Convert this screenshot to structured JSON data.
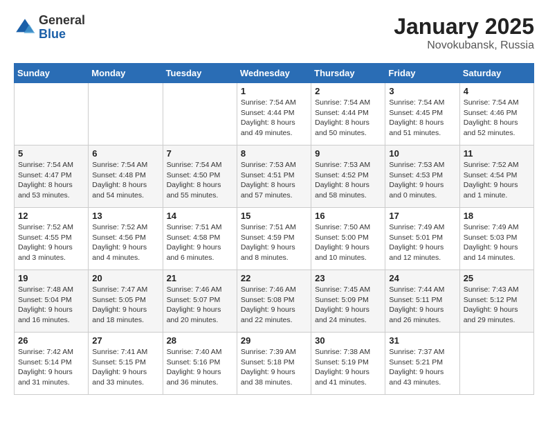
{
  "header": {
    "logo": {
      "general": "General",
      "blue": "Blue"
    },
    "month_year": "January 2025",
    "location": "Novokubansk, Russia"
  },
  "weekdays": [
    "Sunday",
    "Monday",
    "Tuesday",
    "Wednesday",
    "Thursday",
    "Friday",
    "Saturday"
  ],
  "weeks": [
    [
      {
        "day": "",
        "info": ""
      },
      {
        "day": "",
        "info": ""
      },
      {
        "day": "",
        "info": ""
      },
      {
        "day": "1",
        "info": "Sunrise: 7:54 AM\nSunset: 4:44 PM\nDaylight: 8 hours\nand 49 minutes."
      },
      {
        "day": "2",
        "info": "Sunrise: 7:54 AM\nSunset: 4:44 PM\nDaylight: 8 hours\nand 50 minutes."
      },
      {
        "day": "3",
        "info": "Sunrise: 7:54 AM\nSunset: 4:45 PM\nDaylight: 8 hours\nand 51 minutes."
      },
      {
        "day": "4",
        "info": "Sunrise: 7:54 AM\nSunset: 4:46 PM\nDaylight: 8 hours\nand 52 minutes."
      }
    ],
    [
      {
        "day": "5",
        "info": "Sunrise: 7:54 AM\nSunset: 4:47 PM\nDaylight: 8 hours\nand 53 minutes."
      },
      {
        "day": "6",
        "info": "Sunrise: 7:54 AM\nSunset: 4:48 PM\nDaylight: 8 hours\nand 54 minutes."
      },
      {
        "day": "7",
        "info": "Sunrise: 7:54 AM\nSunset: 4:50 PM\nDaylight: 8 hours\nand 55 minutes."
      },
      {
        "day": "8",
        "info": "Sunrise: 7:53 AM\nSunset: 4:51 PM\nDaylight: 8 hours\nand 57 minutes."
      },
      {
        "day": "9",
        "info": "Sunrise: 7:53 AM\nSunset: 4:52 PM\nDaylight: 8 hours\nand 58 minutes."
      },
      {
        "day": "10",
        "info": "Sunrise: 7:53 AM\nSunset: 4:53 PM\nDaylight: 9 hours\nand 0 minutes."
      },
      {
        "day": "11",
        "info": "Sunrise: 7:52 AM\nSunset: 4:54 PM\nDaylight: 9 hours\nand 1 minute."
      }
    ],
    [
      {
        "day": "12",
        "info": "Sunrise: 7:52 AM\nSunset: 4:55 PM\nDaylight: 9 hours\nand 3 minutes."
      },
      {
        "day": "13",
        "info": "Sunrise: 7:52 AM\nSunset: 4:56 PM\nDaylight: 9 hours\nand 4 minutes."
      },
      {
        "day": "14",
        "info": "Sunrise: 7:51 AM\nSunset: 4:58 PM\nDaylight: 9 hours\nand 6 minutes."
      },
      {
        "day": "15",
        "info": "Sunrise: 7:51 AM\nSunset: 4:59 PM\nDaylight: 9 hours\nand 8 minutes."
      },
      {
        "day": "16",
        "info": "Sunrise: 7:50 AM\nSunset: 5:00 PM\nDaylight: 9 hours\nand 10 minutes."
      },
      {
        "day": "17",
        "info": "Sunrise: 7:49 AM\nSunset: 5:01 PM\nDaylight: 9 hours\nand 12 minutes."
      },
      {
        "day": "18",
        "info": "Sunrise: 7:49 AM\nSunset: 5:03 PM\nDaylight: 9 hours\nand 14 minutes."
      }
    ],
    [
      {
        "day": "19",
        "info": "Sunrise: 7:48 AM\nSunset: 5:04 PM\nDaylight: 9 hours\nand 16 minutes."
      },
      {
        "day": "20",
        "info": "Sunrise: 7:47 AM\nSunset: 5:05 PM\nDaylight: 9 hours\nand 18 minutes."
      },
      {
        "day": "21",
        "info": "Sunrise: 7:46 AM\nSunset: 5:07 PM\nDaylight: 9 hours\nand 20 minutes."
      },
      {
        "day": "22",
        "info": "Sunrise: 7:46 AM\nSunset: 5:08 PM\nDaylight: 9 hours\nand 22 minutes."
      },
      {
        "day": "23",
        "info": "Sunrise: 7:45 AM\nSunset: 5:09 PM\nDaylight: 9 hours\nand 24 minutes."
      },
      {
        "day": "24",
        "info": "Sunrise: 7:44 AM\nSunset: 5:11 PM\nDaylight: 9 hours\nand 26 minutes."
      },
      {
        "day": "25",
        "info": "Sunrise: 7:43 AM\nSunset: 5:12 PM\nDaylight: 9 hours\nand 29 minutes."
      }
    ],
    [
      {
        "day": "26",
        "info": "Sunrise: 7:42 AM\nSunset: 5:14 PM\nDaylight: 9 hours\nand 31 minutes."
      },
      {
        "day": "27",
        "info": "Sunrise: 7:41 AM\nSunset: 5:15 PM\nDaylight: 9 hours\nand 33 minutes."
      },
      {
        "day": "28",
        "info": "Sunrise: 7:40 AM\nSunset: 5:16 PM\nDaylight: 9 hours\nand 36 minutes."
      },
      {
        "day": "29",
        "info": "Sunrise: 7:39 AM\nSunset: 5:18 PM\nDaylight: 9 hours\nand 38 minutes."
      },
      {
        "day": "30",
        "info": "Sunrise: 7:38 AM\nSunset: 5:19 PM\nDaylight: 9 hours\nand 41 minutes."
      },
      {
        "day": "31",
        "info": "Sunrise: 7:37 AM\nSunset: 5:21 PM\nDaylight: 9 hours\nand 43 minutes."
      },
      {
        "day": "",
        "info": ""
      }
    ]
  ]
}
